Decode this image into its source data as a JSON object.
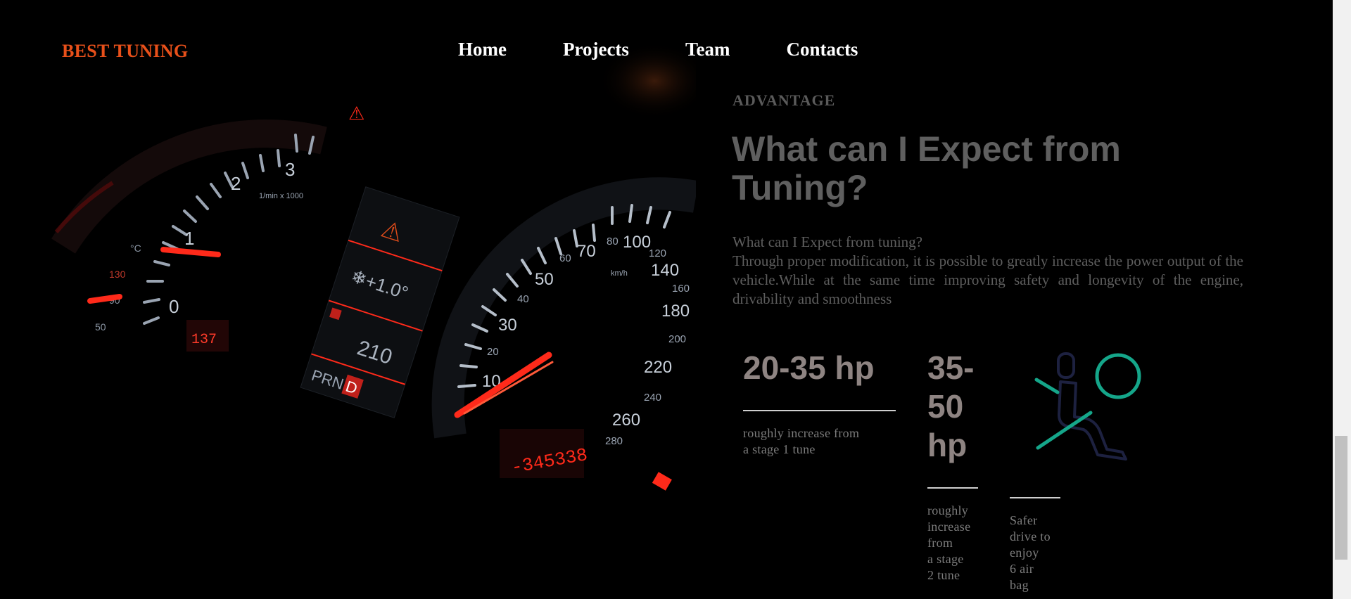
{
  "header": {
    "brand": "BEST TUNING",
    "nav": [
      "Home",
      "Projects",
      "Team",
      "Contacts"
    ]
  },
  "hero": {
    "image_description_icon": "car-dashboard-image",
    "dashboard_readouts": {
      "temperature": "❄+1.0°",
      "fuel_range": "210",
      "gear_selector": "PRND",
      "rpm_unit": "1/min x 1000",
      "speed_unit": "km/h",
      "tach_ticks": [
        "0",
        "1",
        "2",
        "3"
      ],
      "speed_ticks": [
        "10",
        "20",
        "30",
        "40",
        "50",
        "60",
        "70",
        "80",
        "100",
        "120",
        "140",
        "160",
        "180",
        "200",
        "220",
        "240",
        "260",
        "280"
      ],
      "temp_ticks": [
        "°C",
        "130",
        "90",
        "50"
      ]
    }
  },
  "section": {
    "eyebrow": "ADVANTAGE",
    "headline": "What can I Expect from Tuning?",
    "intro_title": "What can I Expect from tuning?",
    "intro_body": "Through proper modification, it is possible to greatly increase the power output of the vehicle.While at the same time improving safety and longevity of the engine, drivability and smoothness"
  },
  "stats": [
    {
      "value": "20-35 hp",
      "desc_line1": "roughly increase from",
      "desc_line2": "a stage 1 tune"
    },
    {
      "value_line1": "35-",
      "value_line2": "50",
      "value_line3": "hp",
      "desc": [
        "roughly",
        "increase",
        "from",
        "a stage",
        "2 tune"
      ]
    },
    {
      "icon": "airbag-seat-icon",
      "desc": [
        "Safer",
        "drive to",
        "enjoy",
        "6 air",
        "bag"
      ]
    }
  ],
  "colors": {
    "brand": "#e8501a",
    "accent_green": "#15a68a",
    "icon_navy": "#1d2140",
    "gauge_red": "#ff2a1a"
  }
}
